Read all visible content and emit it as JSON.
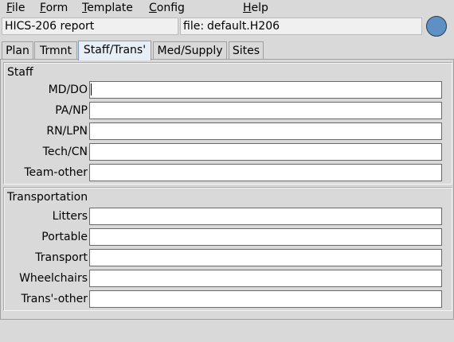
{
  "menubar": {
    "items": [
      {
        "mnemonic": "F",
        "rest": "ile"
      },
      {
        "mnemonic": "F",
        "rest": "orm"
      },
      {
        "mnemonic": "T",
        "rest": "emplate"
      },
      {
        "mnemonic": "C",
        "rest": "onfig"
      },
      {
        "mnemonic": "H",
        "rest": "elp"
      }
    ]
  },
  "header": {
    "report_title": "HICS-206 report",
    "file_prefix": "file:",
    "file_name": "default.H206",
    "status_color": "#5e8fc5"
  },
  "tabs": [
    {
      "label": "Plan",
      "active": false
    },
    {
      "label": "Trmnt",
      "active": false
    },
    {
      "label": "Staff/Trans'",
      "active": true
    },
    {
      "label": "Med/Supply",
      "active": false
    },
    {
      "label": "Sites",
      "active": false
    }
  ],
  "staff": {
    "title": "Staff",
    "rows": [
      {
        "label": "MD/DO",
        "value": ""
      },
      {
        "label": "PA/NP",
        "value": ""
      },
      {
        "label": "RN/LPN",
        "value": ""
      },
      {
        "label": "Tech/CN",
        "value": ""
      },
      {
        "label": "Team-other",
        "value": ""
      }
    ]
  },
  "transportation": {
    "title": "Transportation",
    "rows": [
      {
        "label": "Litters",
        "value": ""
      },
      {
        "label": "Portable",
        "value": ""
      },
      {
        "label": "Transport",
        "value": ""
      },
      {
        "label": "Wheelchairs",
        "value": ""
      },
      {
        "label": "Trans'-other",
        "value": ""
      }
    ]
  }
}
